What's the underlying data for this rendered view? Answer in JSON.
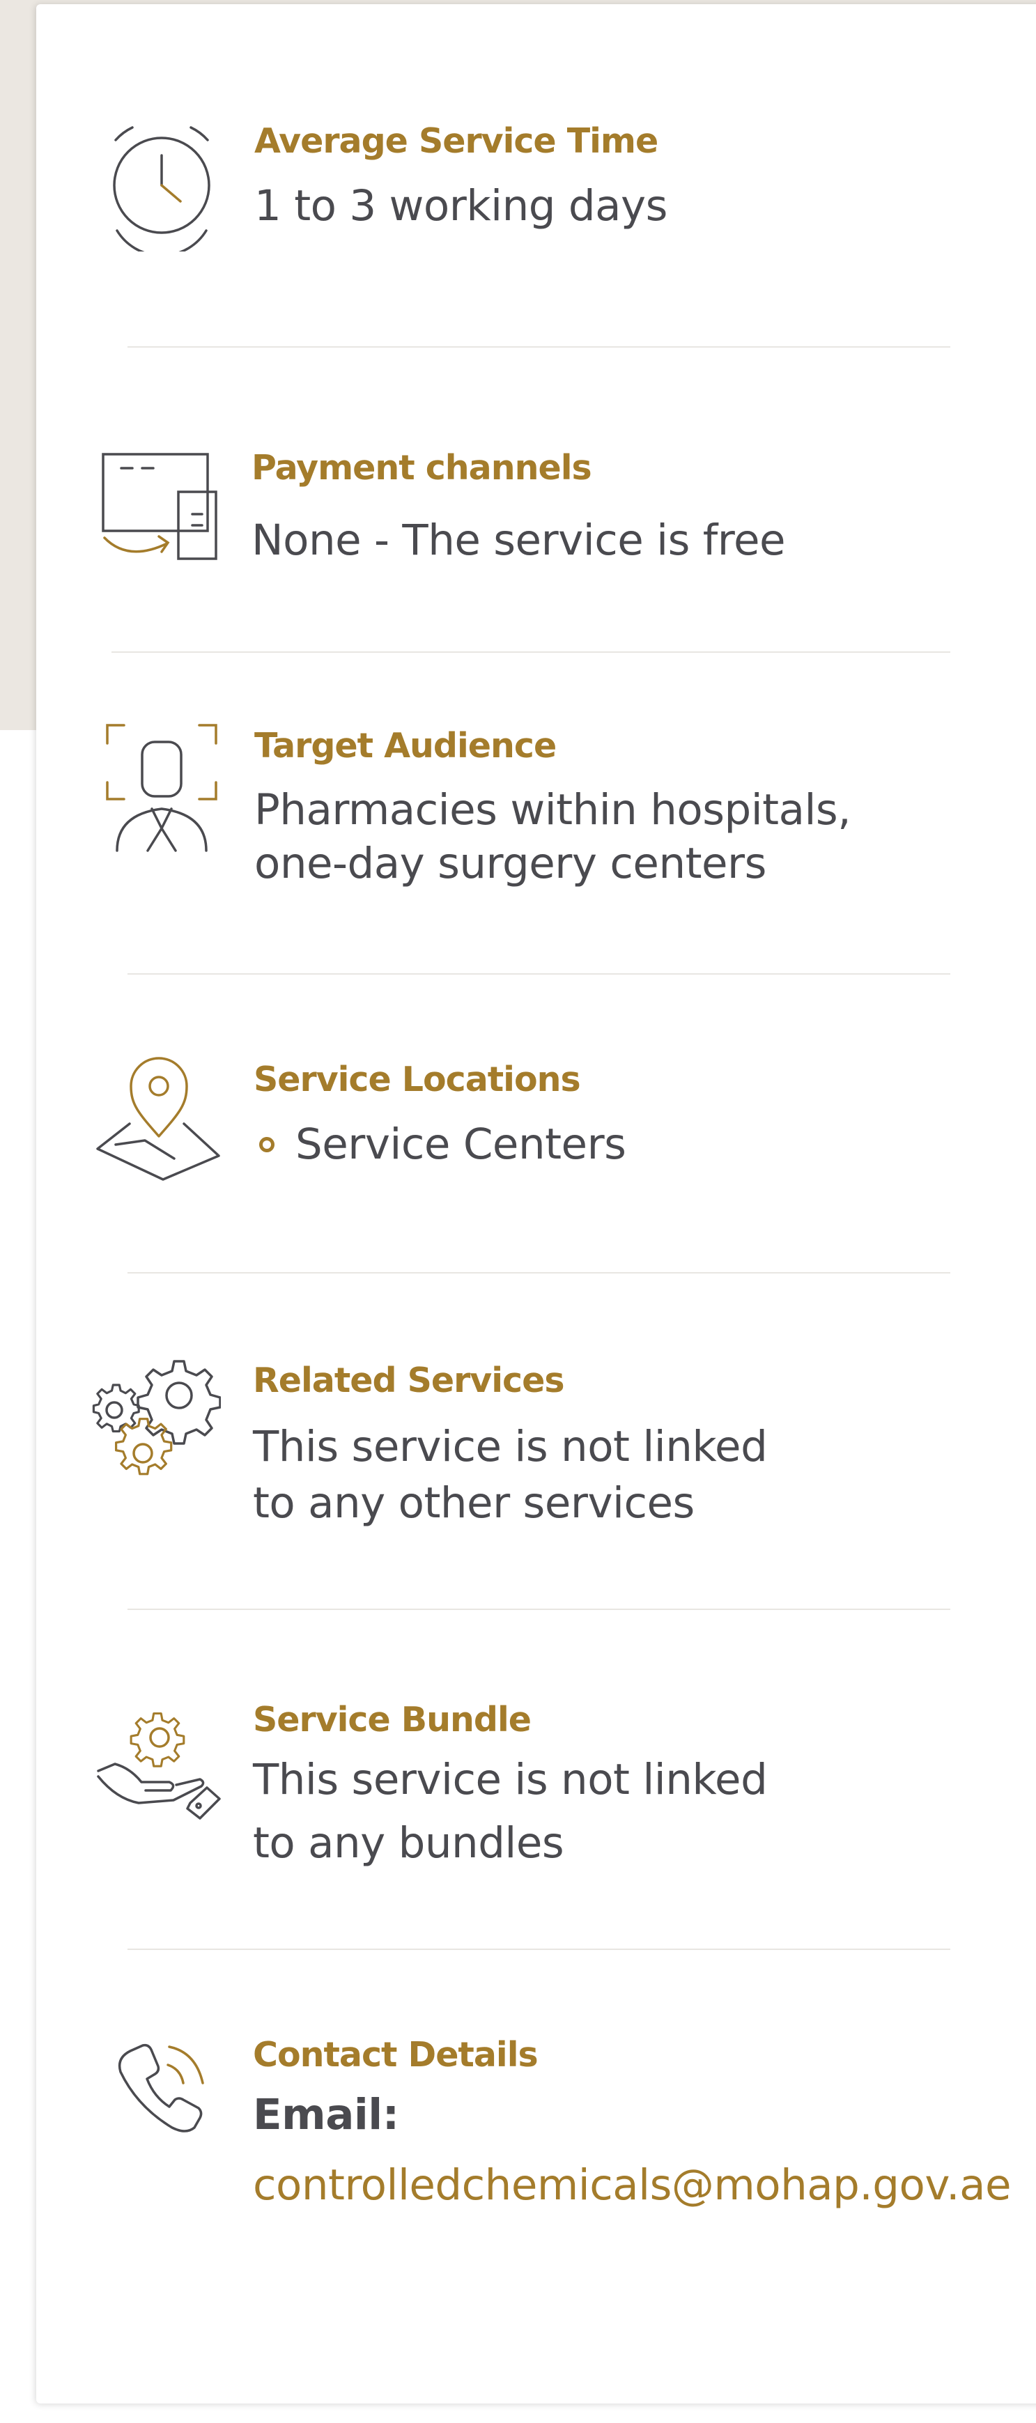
{
  "colors": {
    "accent": "#a47c2b",
    "text": "#4a4a4f",
    "divider": "#e8e6e2",
    "background": "#ebe7e1"
  },
  "average_service_time": {
    "icon": "clock-icon",
    "label": "Average Service Time",
    "value": "1 to 3 working days"
  },
  "payment_channels": {
    "icon": "payment-devices-icon",
    "label": "Payment channels",
    "value": "None - The service is free"
  },
  "target_audience": {
    "icon": "person-focus-icon",
    "label": "Target Audience",
    "value_lines": [
      "Pharmacies within hospitals,",
      "one-day surgery centers"
    ]
  },
  "service_locations": {
    "icon": "map-pin-icon",
    "label": "Service Locations",
    "items": [
      "Service Centers"
    ]
  },
  "related_services": {
    "icon": "gears-icon",
    "label": "Related Services",
    "value_lines": [
      "This service is not linked",
      "to any other services"
    ]
  },
  "service_bundle": {
    "icon": "hand-gear-icon",
    "label": "Service Bundle",
    "value_lines": [
      "This service is not linked",
      "to any bundles"
    ]
  },
  "contact_details": {
    "icon": "phone-icon",
    "label": "Contact Details",
    "email_label": "Email:",
    "email": "controlledchemicals@mohap.gov.ae"
  }
}
